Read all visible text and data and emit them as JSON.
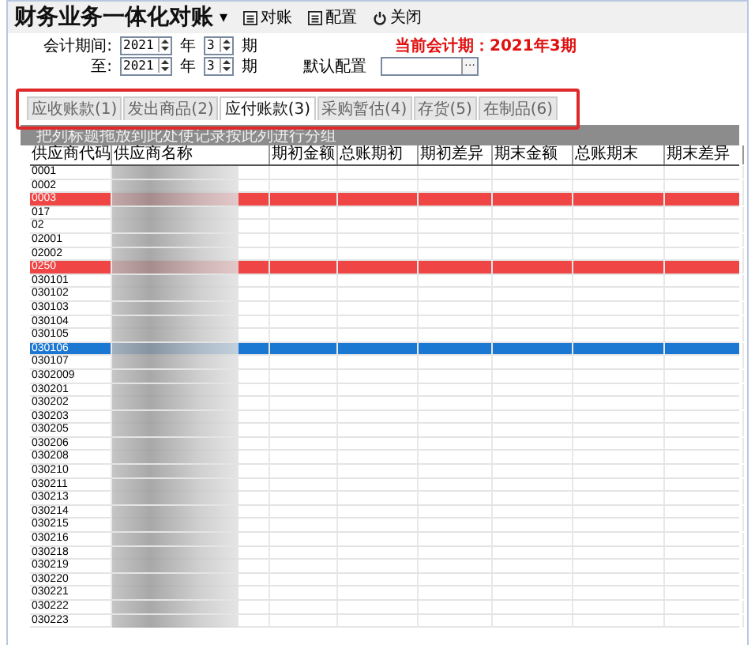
{
  "window": {
    "title": "财务业务一体化对账",
    "title_menu": "▾"
  },
  "toolbar": [
    {
      "kind": "doc",
      "label": "对账"
    },
    {
      "kind": "doc",
      "label": "配置"
    },
    {
      "kind": "power",
      "label": "关闭"
    }
  ],
  "period": {
    "from_label": "会计期间:",
    "to_label": "至:",
    "from_year": "2021",
    "from_period": "3",
    "to_year": "2021",
    "to_period": "3",
    "from_year_unit": "年",
    "from_period_unit": "期",
    "to_year_unit": "年",
    "to_period_unit": "期",
    "config_label": "默认配置",
    "config_button": "···",
    "current": "当前会计期：2021年3期"
  },
  "tabs": [
    {
      "label": "应收账款(1)",
      "selected": false
    },
    {
      "label": "发出商品(2)",
      "selected": false
    },
    {
      "label": "应付账款(3)",
      "selected": true
    },
    {
      "label": "采购暂估(4)",
      "selected": false
    },
    {
      "label": "存货(5)",
      "selected": false
    },
    {
      "label": "在制品(6)",
      "selected": false
    }
  ],
  "group_hint": "把列标题拖放到此处使记录按此列进行分组",
  "table": {
    "columns": [
      "供应商代码",
      "供应商名称",
      "期初金额",
      "总账期初",
      "期初差异",
      "期末金额",
      "总账期末",
      "期末差异"
    ],
    "rows": [
      {
        "code": "0001",
        "flagged": false,
        "selected": false
      },
      {
        "code": "0002",
        "flagged": false,
        "selected": false
      },
      {
        "code": "0003",
        "flagged": true,
        "selected": false
      },
      {
        "code": "017",
        "flagged": false,
        "selected": false
      },
      {
        "code": "02",
        "flagged": false,
        "selected": false
      },
      {
        "code": "02001",
        "flagged": false,
        "selected": false
      },
      {
        "code": "02002",
        "flagged": false,
        "selected": false
      },
      {
        "code": "0250",
        "flagged": true,
        "selected": false
      },
      {
        "code": "030101",
        "flagged": false,
        "selected": false
      },
      {
        "code": "030102",
        "flagged": false,
        "selected": false
      },
      {
        "code": "030103",
        "flagged": false,
        "selected": false
      },
      {
        "code": "030104",
        "flagged": false,
        "selected": false
      },
      {
        "code": "030105",
        "flagged": false,
        "selected": false
      },
      {
        "code": "030106",
        "flagged": false,
        "selected": true
      },
      {
        "code": "030107",
        "flagged": false,
        "selected": false
      },
      {
        "code": "0302009",
        "flagged": false,
        "selected": false
      },
      {
        "code": "030201",
        "flagged": false,
        "selected": false
      },
      {
        "code": "030202",
        "flagged": false,
        "selected": false
      },
      {
        "code": "030203",
        "flagged": false,
        "selected": false
      },
      {
        "code": "030205",
        "flagged": false,
        "selected": false
      },
      {
        "code": "030206",
        "flagged": false,
        "selected": false
      },
      {
        "code": "030208",
        "flagged": false,
        "selected": false
      },
      {
        "code": "030210",
        "flagged": false,
        "selected": false
      },
      {
        "code": "030211",
        "flagged": false,
        "selected": false
      },
      {
        "code": "030213",
        "flagged": false,
        "selected": false
      },
      {
        "code": "030214",
        "flagged": false,
        "selected": false
      },
      {
        "code": "030215",
        "flagged": false,
        "selected": false
      },
      {
        "code": "030216",
        "flagged": false,
        "selected": false
      },
      {
        "code": "030218",
        "flagged": false,
        "selected": false
      },
      {
        "code": "030219",
        "flagged": false,
        "selected": false
      },
      {
        "code": "030220",
        "flagged": false,
        "selected": false
      },
      {
        "code": "030221",
        "flagged": false,
        "selected": false
      },
      {
        "code": "030222",
        "flagged": false,
        "selected": false
      },
      {
        "code": "030223",
        "flagged": false,
        "selected": false
      }
    ]
  }
}
